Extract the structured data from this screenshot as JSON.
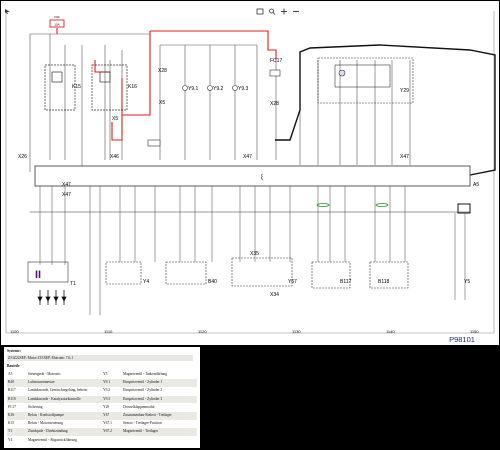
{
  "diagram": {
    "code": "P98101",
    "fuses": [
      "F60",
      "F63"
    ],
    "fuse_rating": "15A",
    "components": {
      "k15": "K15",
      "k16": "K16",
      "x28": "X28",
      "x5": "X5",
      "x46": "X46",
      "y9_1": "Y9.1",
      "y9_2": "Y9.2",
      "y9_3": "Y9.3",
      "fc17": "FC17",
      "x28_b": "X28",
      "y29": "Y29",
      "x26": "X26",
      "x47_a": "X47",
      "x47_b": "X47",
      "x47_c": "X47",
      "a5": "A5",
      "x47_d": "X47",
      "t1": "T1",
      "y4": "Y4",
      "b40": "B40",
      "x35": "X35",
      "x34": "X34",
      "y67": "Y67",
      "b117": "B117",
      "b118": "B118",
      "y5": "Y5"
    },
    "grid_numbers": [
      "1100",
      "1110",
      "1120",
      "1130",
      "1140",
      "1150"
    ]
  },
  "legend": {
    "title": "Systeme:",
    "system": "Z/GZ22SEP: Motor Z15XEP, Motronic 7.6.1",
    "components_heading": "Bauteile",
    "rows": [
      {
        "c1": "A5",
        "c2": "Steuergerät - Motronic",
        "c3": "Y5",
        "c4": "Magnetventil - Tankentlüftung"
      },
      {
        "c1": "B40",
        "c2": "Luftmassenmesser",
        "c3": "Y9.1",
        "c4": "Einspritzventil - Zylinder 1"
      },
      {
        "c1": "B117",
        "c2": "Lambdasonde, Gemischregelung, beheizt",
        "c3": "Y9.2",
        "c4": "Einspritzventil - Zylinder 2"
      },
      {
        "c1": "B118",
        "c2": "Lambdasonde - Katalysatorkontrolle",
        "c3": "Y9.3",
        "c4": "Einspritzventil - Zylinder 3"
      },
      {
        "c1": "FC17",
        "c2": "Sicherung",
        "c3": "Y29",
        "c4": "Drosselklappenmodul"
      },
      {
        "c1": "K16",
        "c2": "Relais - Kraftstoffpumpe",
        "c3": "Y67",
        "c4": "Zusammenbau-Einheit - Tretlager"
      },
      {
        "c1": "K15",
        "c2": "Relais - Motorsteuerung",
        "c3": "Y67.1",
        "c4": "Sensor - Tretlager-Position"
      },
      {
        "c1": "T1",
        "c2": "Zündspule - Direktzündung",
        "c3": "Y67.2",
        "c4": "Magnetventil - Tretlager"
      },
      {
        "c1": "Y4",
        "c2": "Magnetventil - Abgasrückführung",
        "c3": "",
        "c4": ""
      }
    ]
  },
  "colors": {
    "highlight": "#dd2020",
    "harness": "#000000",
    "shielding": "#2f8f2f",
    "toolbar_icon": "#333333"
  }
}
